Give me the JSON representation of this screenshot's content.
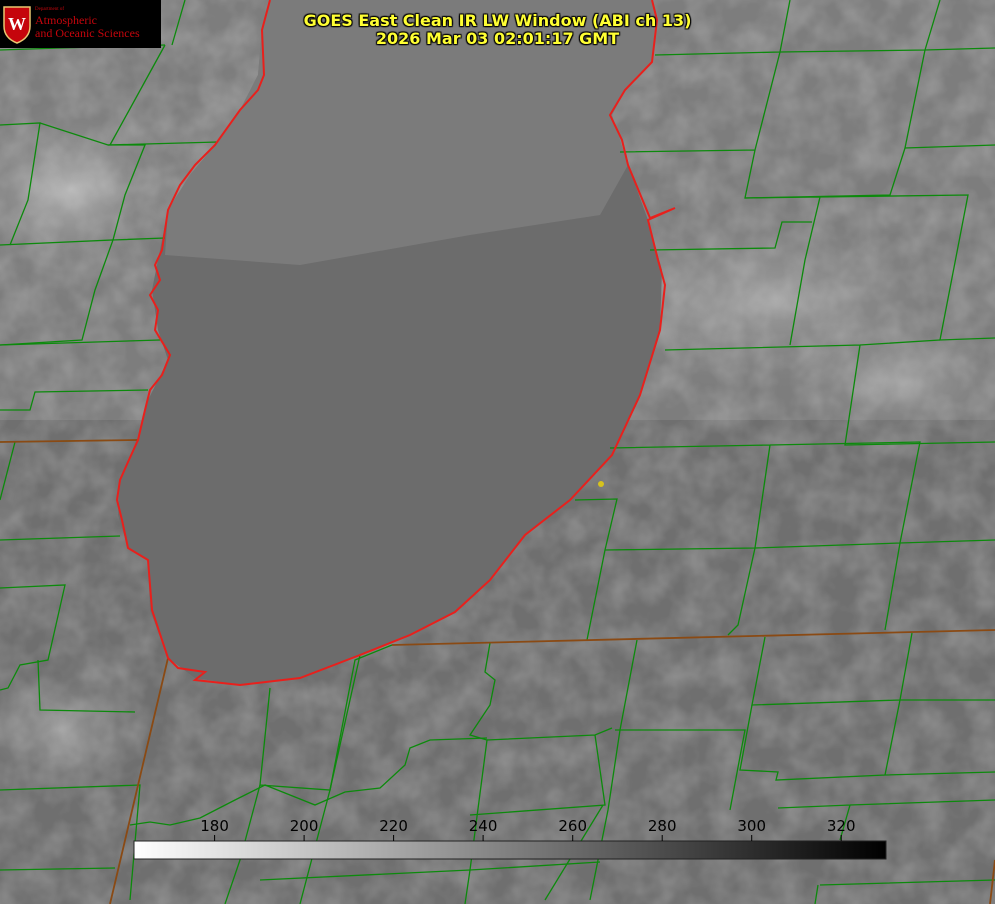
{
  "title": {
    "line1": "GOES East Clean IR LW Window (ABI ch 13)",
    "line2": "2026 Mar 03 02:01:17 GMT"
  },
  "logo": {
    "department": "Department of",
    "line1": "Atmospheric",
    "line2": "and Oceanic Sciences",
    "seal_letter": "W"
  },
  "colorbar": {
    "tick_labels": [
      "180",
      "200",
      "220",
      "240",
      "260",
      "280",
      "300",
      "320"
    ],
    "range_min": 162,
    "range_max": 330,
    "colormap": "white-to-black"
  },
  "colors": {
    "coastline": "#e8201c",
    "state_border": "#8a4a14",
    "county_lines": "#0c8a0c",
    "station_marker": "#d6c21c",
    "title_text": "#ffff33"
  }
}
